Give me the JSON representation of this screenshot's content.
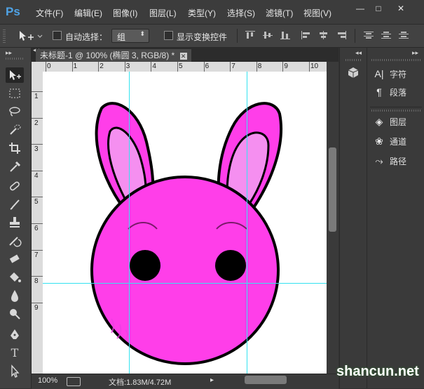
{
  "app": {
    "logo": "Ps"
  },
  "menu": [
    "文件(F)",
    "编辑(E)",
    "图像(I)",
    "图层(L)",
    "类型(Y)",
    "选择(S)",
    "滤镜(T)",
    "视图(V)"
  ],
  "window_buttons": {
    "minimize": "—",
    "restore": "□",
    "close": "✕"
  },
  "options": {
    "auto_select_label": "自动选择：",
    "group_value": "组",
    "show_transform_label": "显示变换控件"
  },
  "document": {
    "tab_title": "未标题-1 @ 100% (椭圆 3, RGB/8) *",
    "tab_close": "✕",
    "ruler_top_labels": [
      "0",
      "1",
      "2",
      "3",
      "4",
      "5",
      "6",
      "7",
      "8",
      "9",
      "10"
    ],
    "ruler_left_labels": [
      "1",
      "2",
      "3",
      "4",
      "5",
      "6",
      "7",
      "8",
      "9"
    ]
  },
  "status": {
    "zoom": "100%",
    "doc_info": "文档:1.83M/4.72M"
  },
  "panels": {
    "group1": [
      {
        "icon": "A|",
        "label": "字符"
      },
      {
        "icon": "¶",
        "label": "段落"
      }
    ],
    "group2": [
      {
        "icon": "◈",
        "label": "图层"
      },
      {
        "icon": "❀",
        "label": "通道"
      },
      {
        "icon": "⤳",
        "label": "路径"
      }
    ]
  },
  "watermark": "shancun.net",
  "colors": {
    "rabbit_body": "#ff3ee9",
    "rabbit_inner_ear": "#f58ff0",
    "guide": "#33e3f0"
  }
}
